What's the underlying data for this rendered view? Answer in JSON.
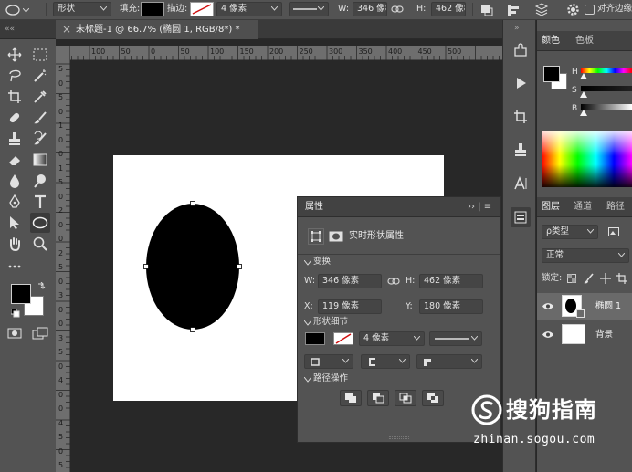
{
  "options_bar": {
    "mode": "形状",
    "fill_label": "填充:",
    "stroke_label": "描边:",
    "stroke_width": "4 像素",
    "w_label": "W:",
    "w_value": "346 像Ɛ",
    "h_label": "H:",
    "h_value": "462 像Ɛ",
    "align_edges_label": "对齐边缘"
  },
  "document": {
    "tab_title": "未标题-1 @ 66.7% (椭圆 1, RGB/8*) *",
    "close_glyph": "×"
  },
  "ruler": {
    "h_labels": [
      "100",
      "50",
      "0",
      "50",
      "100",
      "150",
      "200",
      "250",
      "300",
      "350",
      "400",
      "450",
      "500"
    ],
    "v_labels": [
      "5",
      "0",
      "5",
      "0",
      "1",
      "0",
      "0",
      "1",
      "5",
      "0",
      "2",
      "0",
      "0",
      "2",
      "5",
      "0",
      "3",
      "0",
      "0",
      "3",
      "5",
      "0",
      "4",
      "0",
      "0",
      "4",
      "5",
      "0",
      "5"
    ]
  },
  "properties": {
    "title": "属性",
    "header_glyphs": "›› | ≡",
    "subtitle": "实时形状属性",
    "sections": {
      "transform": "变换",
      "shape_details": "形状细节",
      "path_ops": "路径操作"
    },
    "transform": {
      "w_label": "W:",
      "w_value": "346 像素",
      "h_label": "H:",
      "h_value": "462 像素",
      "x_label": "X:",
      "x_value": "119 像素",
      "y_label": "Y:",
      "y_value": "180 像素"
    },
    "stroke_width": "4 像素"
  },
  "color_panel": {
    "tab_color": "颜色",
    "tab_swatches": "色板",
    "h_label": "H",
    "s_label": "S",
    "b_label": "B"
  },
  "layers_panel": {
    "tab_layers": "图层",
    "tab_channels": "通道",
    "tab_paths": "路径",
    "filter_label": "ρ类型",
    "blend_mode": "正常",
    "lock_label": "锁定:",
    "layers": [
      {
        "name": "椭圆 1"
      },
      {
        "name": "背景"
      }
    ]
  },
  "watermark": {
    "brand": "搜狗指南",
    "url": "zhinan.sogou.com"
  },
  "colors": {
    "app_bg": "#282828",
    "panel": "#535353",
    "foreground_swatch": "#000000",
    "background_swatch": "#ffffff"
  }
}
